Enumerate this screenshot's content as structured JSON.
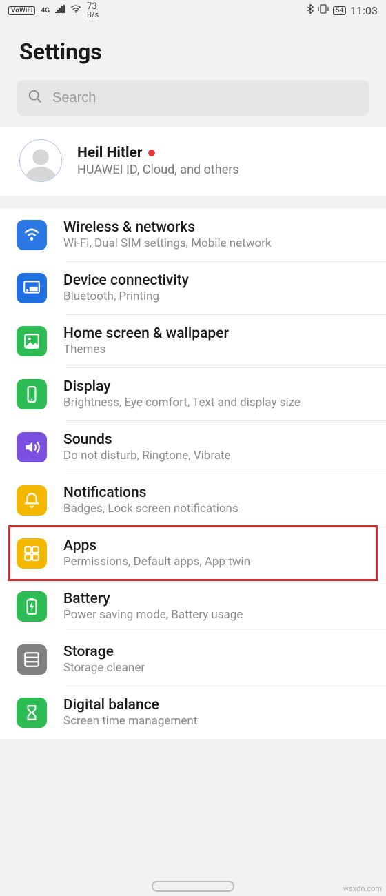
{
  "status": {
    "vowifi": "VoWiFi",
    "net_label": "4G",
    "speed_value": "73",
    "speed_unit": "B/s",
    "battery": "54",
    "time": "11:03"
  },
  "header": {
    "title": "Settings"
  },
  "search": {
    "placeholder": "Search"
  },
  "account": {
    "name": "Heil Hitler",
    "subtitle": "HUAWEI ID, Cloud, and others"
  },
  "items": [
    {
      "icon": "wifi-icon",
      "color": "c-blue",
      "title": "Wireless & networks",
      "sub": "Wi-Fi, Dual SIM settings, Mobile network"
    },
    {
      "icon": "cast-icon",
      "color": "c-blue2",
      "title": "Device connectivity",
      "sub": "Bluetooth, Printing"
    },
    {
      "icon": "image-icon",
      "color": "c-green",
      "title": "Home screen & wallpaper",
      "sub": "Themes"
    },
    {
      "icon": "phone-icon",
      "color": "c-green",
      "title": "Display",
      "sub": "Brightness, Eye comfort, Text and display size"
    },
    {
      "icon": "sound-icon",
      "color": "c-violet",
      "title": "Sounds",
      "sub": "Do not disturb, Ringtone, Vibrate"
    },
    {
      "icon": "bell-icon",
      "color": "c-amber",
      "title": "Notifications",
      "sub": "Badges, Lock screen notifications"
    },
    {
      "icon": "apps-icon",
      "color": "c-amber",
      "title": "Apps",
      "sub": "Permissions, Default apps, App twin",
      "highlight": true
    },
    {
      "icon": "battery-icon",
      "color": "c-green",
      "title": "Battery",
      "sub": "Power saving mode, Battery usage"
    },
    {
      "icon": "storage-icon",
      "color": "c-grey",
      "title": "Storage",
      "sub": "Storage cleaner"
    },
    {
      "icon": "hourglass-icon",
      "color": "c-green",
      "title": "Digital balance",
      "sub": "Screen time management"
    }
  ],
  "watermark": "wsxdn.com"
}
